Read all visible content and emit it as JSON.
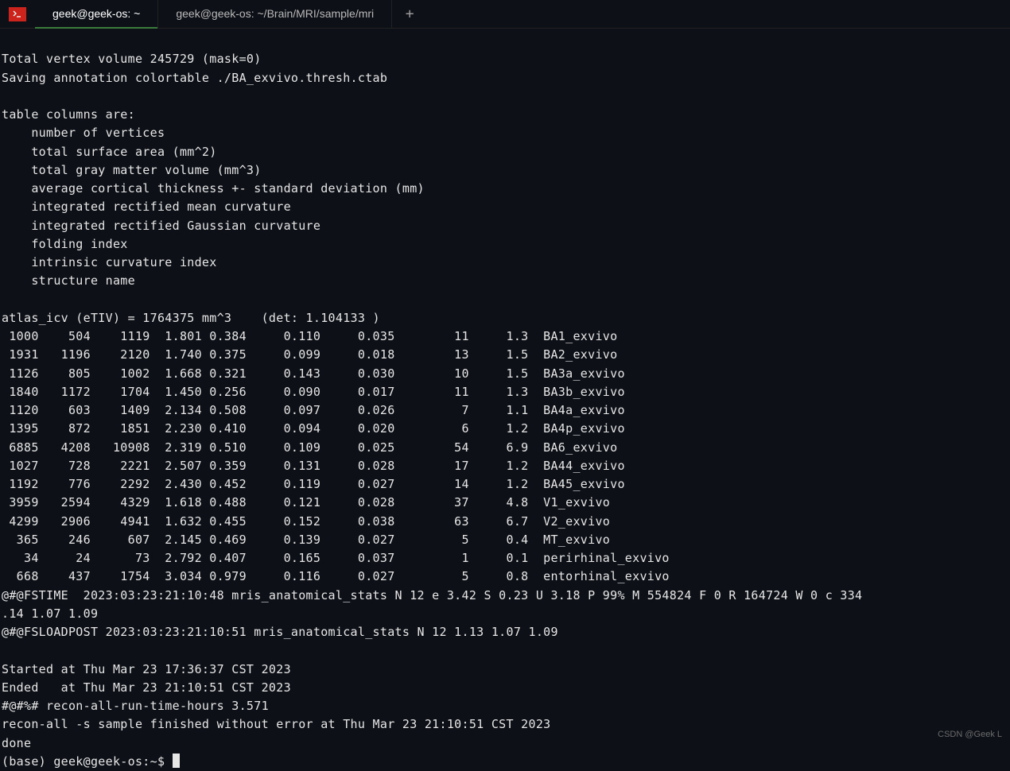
{
  "tabs": {
    "active": "geek@geek-os: ~",
    "inactive": "geek@geek-os: ~/Brain/MRI/sample/mri"
  },
  "header": {
    "line1": "Total vertex volume 245729 (mask=0)",
    "line2": "Saving annotation colortable ./BA_exvivo.thresh.ctab",
    "cols_intro": "table columns are:",
    "cols": {
      "c1": "    number of vertices",
      "c2": "    total surface area (mm^2)",
      "c3": "    total gray matter volume (mm^3)",
      "c4": "    average cortical thickness +- standard deviation (mm)",
      "c5": "    integrated rectified mean curvature",
      "c6": "    integrated rectified Gaussian curvature",
      "c7": "    folding index",
      "c8": "    intrinsic curvature index",
      "c9": "    structure name"
    },
    "icv": "atlas_icv (eTIV) = 1764375 mm^3    (det: 1.104133 )"
  },
  "rows": {
    "r0": " 1000    504    1119  1.801 0.384     0.110     0.035        11     1.3  BA1_exvivo",
    "r1": " 1931   1196    2120  1.740 0.375     0.099     0.018        13     1.5  BA2_exvivo",
    "r2": " 1126    805    1002  1.668 0.321     0.143     0.030        10     1.5  BA3a_exvivo",
    "r3": " 1840   1172    1704  1.450 0.256     0.090     0.017        11     1.3  BA3b_exvivo",
    "r4": " 1120    603    1409  2.134 0.508     0.097     0.026         7     1.1  BA4a_exvivo",
    "r5": " 1395    872    1851  2.230 0.410     0.094     0.020         6     1.2  BA4p_exvivo",
    "r6": " 6885   4208   10908  2.319 0.510     0.109     0.025        54     6.9  BA6_exvivo",
    "r7": " 1027    728    2221  2.507 0.359     0.131     0.028        17     1.2  BA44_exvivo",
    "r8": " 1192    776    2292  2.430 0.452     0.119     0.027        14     1.2  BA45_exvivo",
    "r9": " 3959   2594    4329  1.618 0.488     0.121     0.028        37     4.8  V1_exvivo",
    "r10": " 4299   2906    4941  1.632 0.455     0.152     0.038        63     6.7  V2_exvivo",
    "r11": "  365    246     607  2.145 0.469     0.139     0.027         5     0.4  MT_exvivo",
    "r12": "   34     24      73  2.792 0.407     0.165     0.037         1     0.1  perirhinal_exvivo",
    "r13": "  668    437    1754  3.034 0.979     0.116     0.027         5     0.8  entorhinal_exvivo"
  },
  "footer": {
    "fstime": "@#@FSTIME  2023:03:23:21:10:48 mris_anatomical_stats N 12 e 3.42 S 0.23 U 3.18 P 99% M 554824 F 0 R 164724 W 0 c 334",
    "fstime2": ".14 1.07 1.09",
    "fsload": "@#@FSLOADPOST 2023:03:23:21:10:51 mris_anatomical_stats N 12 1.13 1.07 1.09",
    "started": "Started at Thu Mar 23 17:36:37 CST 2023",
    "ended": "Ended   at Thu Mar 23 21:10:51 CST 2023",
    "runtime": "#@#%# recon-all-run-time-hours 3.571",
    "finished": "recon-all -s sample finished without error at Thu Mar 23 21:10:51 CST 2023",
    "done": "done",
    "prompt": "(base) geek@geek-os:~$ "
  },
  "watermark": "CSDN @Geek L"
}
